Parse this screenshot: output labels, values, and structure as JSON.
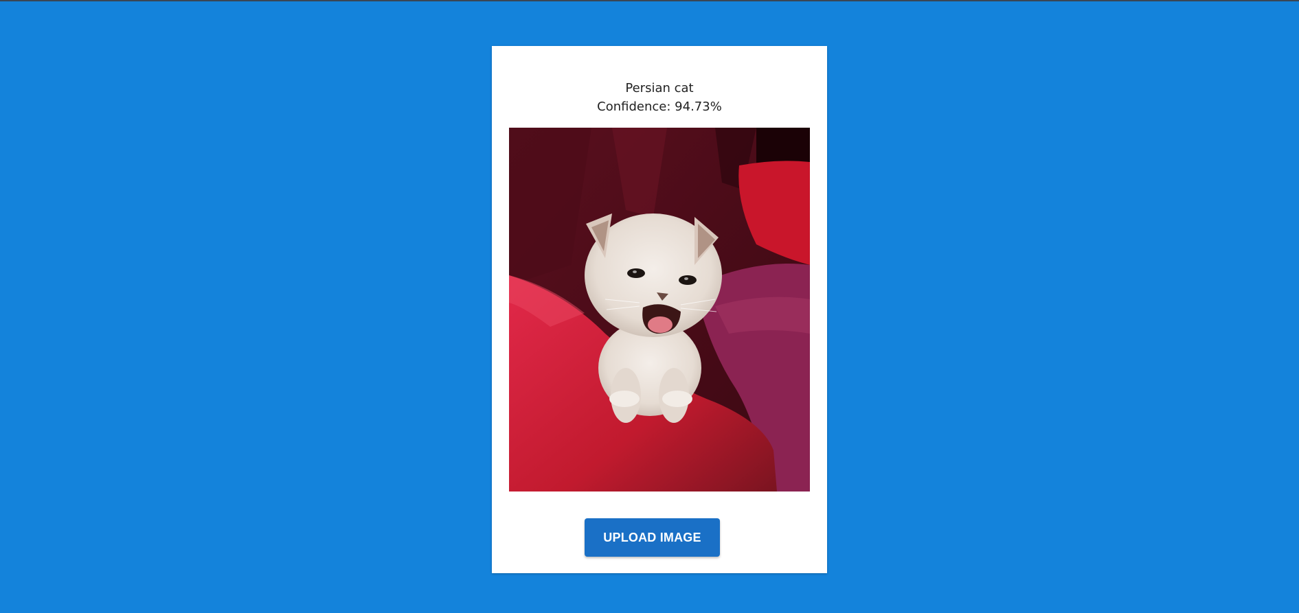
{
  "prediction": {
    "label": "Persian cat",
    "confidence_text": "Confidence: 94.73%"
  },
  "image": {
    "subject": "kitten-photo"
  },
  "upload": {
    "button_label": "UPLOAD IMAGE"
  },
  "colors": {
    "background": "#1483db",
    "card": "#ffffff",
    "button": "#1a70c6",
    "button_text": "#ffffff"
  }
}
